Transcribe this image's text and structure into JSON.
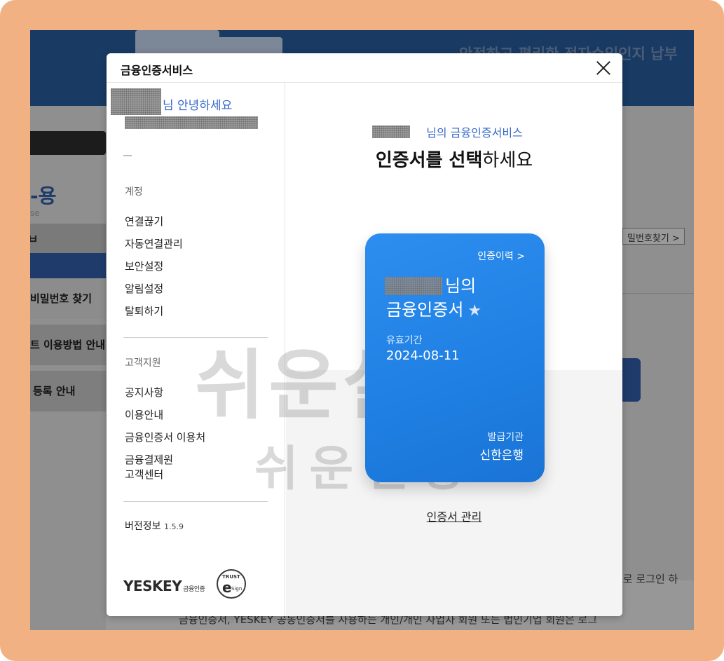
{
  "background": {
    "banner_text": "안전하고 편리한 전자수입인지 납부",
    "left_title": "-용",
    "left_sub": "se",
    "left_strip": "ㅂ",
    "left_items": [
      "비밀번호 찾기",
      "트 이용방법 안내",
      "등록 안내"
    ],
    "right_button": "밀번호찾기 >",
    "right_text": "으로 로그인 하",
    "bottom_text": "금융인증서, YESKEY 공동인증서를 사용하는 개인/개인 사업자 회원 또는 법인기업 회원은 로그"
  },
  "modal": {
    "title": "금융인증서비스",
    "close_label": "닫기"
  },
  "sidebar": {
    "greeting": "님 안녕하세요",
    "dash": "–",
    "account_label": "계정",
    "account_items": [
      "연결끊기",
      "자동연결관리",
      "보안설정",
      "알림설정",
      "탈퇴하기"
    ],
    "support_label": "고객지원",
    "support_items": [
      "공지사항",
      "이용안내",
      "금융인증서 이용처",
      "금융결제원\n고객센터"
    ],
    "version_label": "버전정보",
    "version_number": "1.5.9",
    "brand": "YESKEY",
    "brand_sub": "금융인증",
    "trust_top": "TRUST",
    "trust_mid": "e",
    "trust_bottom": "Sign"
  },
  "main": {
    "owner_line": "님의 금융인증서비스",
    "headline_bold": "인증서를 선택",
    "headline_rest": "하세요",
    "watermark_big": "쉬운설명",
    "watermark_small": "쉬운설명"
  },
  "certificate": {
    "history_label": "인증이력 >",
    "name_suffix": "님의",
    "name_line2": "금융인증서",
    "favorite_icon": "star-icon",
    "valid_label": "유효기간",
    "valid_date": "2024-08-11",
    "issuer_label": "발급기관",
    "issuer_name": "신한은행",
    "manage_label": "인증서 관리"
  }
}
